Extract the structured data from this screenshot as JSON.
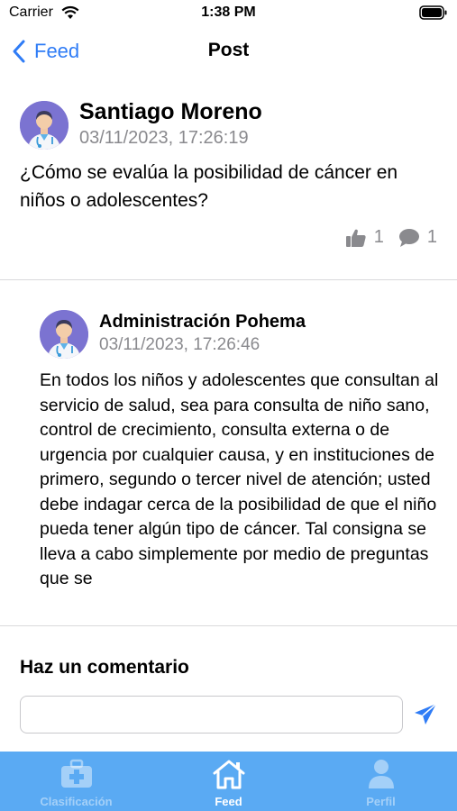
{
  "status_bar": {
    "carrier": "Carrier",
    "time": "1:38 PM"
  },
  "nav": {
    "back_label": "Feed",
    "title": "Post"
  },
  "post": {
    "author": "Santiago Moreno",
    "date": "03/11/2023, 17:26:19",
    "question": "¿Cómo se evalúa la posibilidad de cáncer en niños o adolescentes?",
    "likes": "1",
    "comments": "1"
  },
  "reply": {
    "author": "Administración Pohema",
    "date": "03/11/2023, 17:26:46",
    "body": "En todos los niños y adolescentes que consultan al servicio de salud, sea para consulta de niño sano, control de crecimiento, consulta externa o de urgencia por cualquier causa, y en instituciones de primero, segundo o tercer nivel de atención; usted debe indagar cerca de la posibilidad de que el niño pueda tener algún tipo de cáncer. Tal consigna se lleva a cabo simplemente por medio de preguntas que se"
  },
  "comment": {
    "title": "Haz un comentario",
    "input_value": "",
    "placeholder": ""
  },
  "tabs": [
    {
      "label": "Clasificación",
      "icon": "medical-kit-icon",
      "active": false
    },
    {
      "label": "Feed",
      "icon": "home-icon",
      "active": true
    },
    {
      "label": "Perfil",
      "icon": "person-icon",
      "active": false
    }
  ],
  "colors": {
    "accent": "#2f7cf6",
    "tab_bar": "#5aaaf3",
    "avatar_bg": "#7b73d1",
    "muted_text": "#8a8a8e"
  }
}
